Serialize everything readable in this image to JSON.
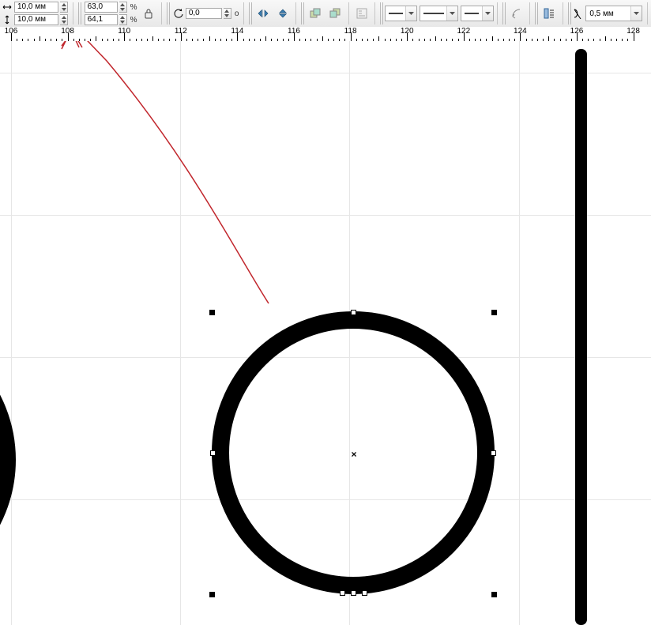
{
  "size": {
    "w_value": "10,0 мм",
    "h_value": "10,0 мм"
  },
  "scale": {
    "x_value": "63,0",
    "y_value": "64,1",
    "unit": "%"
  },
  "lock_label": "lock",
  "rotation": {
    "value": "0,0",
    "unit": "o"
  },
  "outline": {
    "width_value": "0,5 мм"
  },
  "line_style": {
    "start": "—",
    "mid": "—",
    "end": "—"
  },
  "ruler": {
    "labels": [
      "106",
      "108",
      "110",
      "112",
      "114",
      "116",
      "118",
      "120",
      "122",
      "124",
      "126",
      "128"
    ]
  }
}
